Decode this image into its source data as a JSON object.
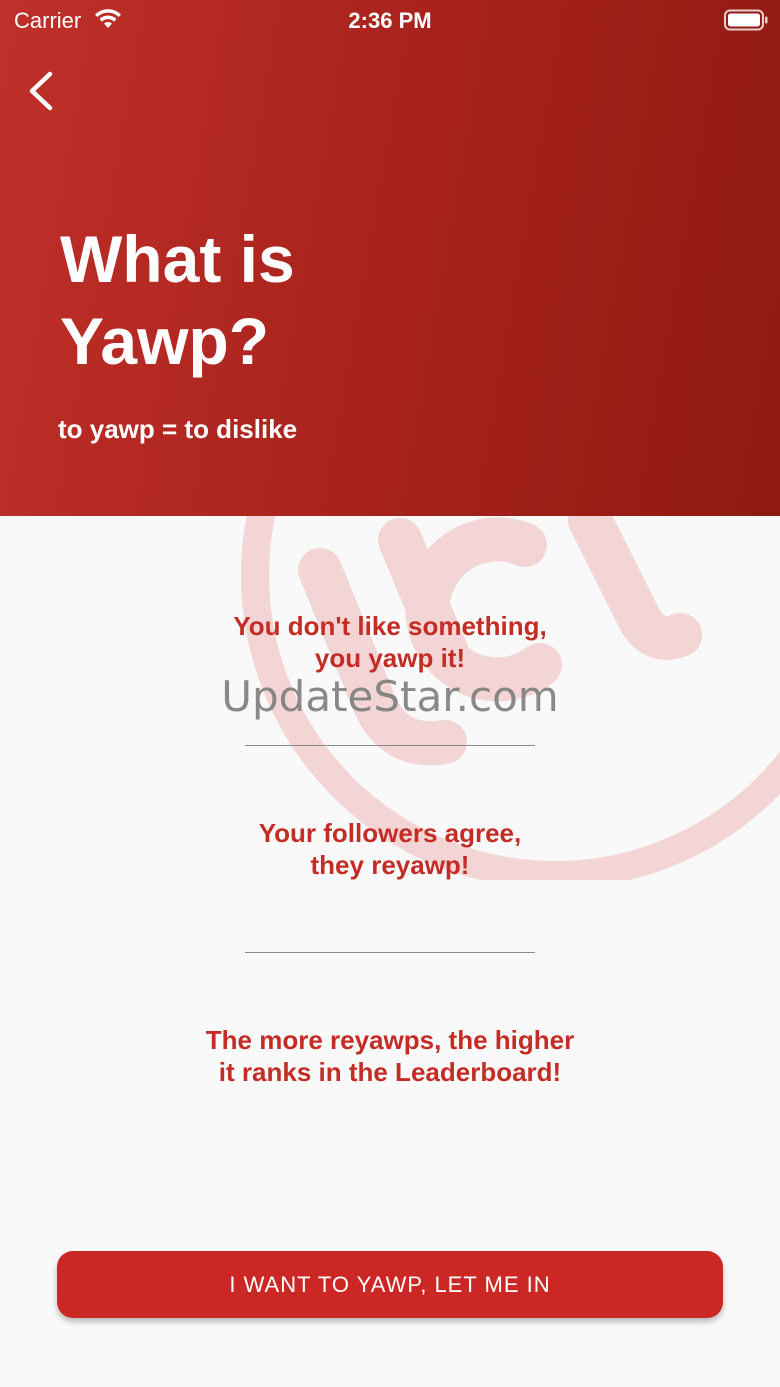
{
  "status_bar": {
    "carrier": "Carrier",
    "time": "2:36 PM"
  },
  "header": {
    "title_line1": "What is",
    "title_line2": "Yawp?",
    "subtitle": "to yawp = to dislike",
    "back_icon": "chevron-left-icon"
  },
  "content": {
    "block1_line1": "You don't like something,",
    "block1_line2": "you yawp it!",
    "block2_line1": "Your followers agree,",
    "block2_line2": "they reyawp!",
    "block3_line1": "The more reyawps, the higher",
    "block3_line2": "it ranks in the Leaderboard!"
  },
  "watermark": {
    "text": "UpdateStar.com"
  },
  "cta": {
    "label": "I WANT TO YAWP, LET ME IN"
  },
  "colors": {
    "header_start": "#c0302a",
    "header_end": "#8f1a12",
    "accent_text": "#c42d26",
    "button": "#cb2724",
    "background": "#f9f9f9"
  }
}
